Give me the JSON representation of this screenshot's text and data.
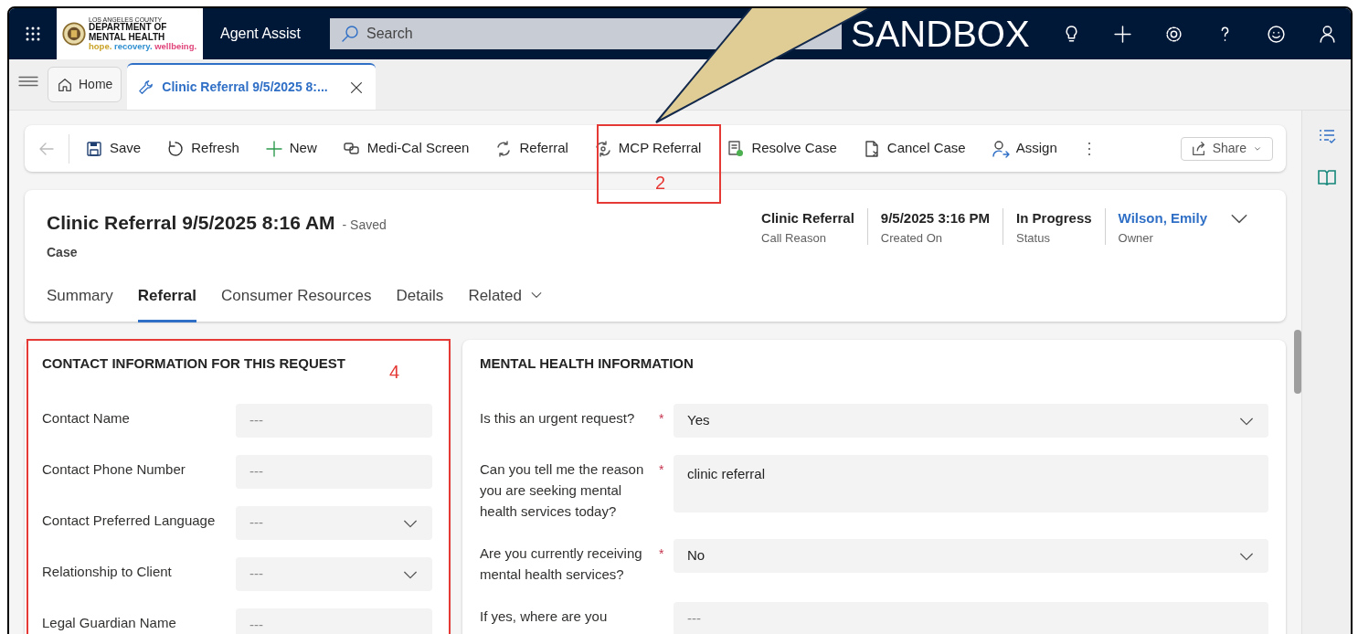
{
  "header": {
    "logo": {
      "lines": [
        "LOS ANGELES COUNTY",
        "DEPARTMENT OF",
        "MENTAL HEALTH"
      ],
      "tagline": [
        {
          "text": "hope.",
          "color": "#c9a227"
        },
        {
          "text": "recovery.",
          "color": "#2f8fd0"
        },
        {
          "text": "wellbeing.",
          "color": "#e0457b"
        }
      ]
    },
    "app_name": "Agent Assist",
    "search": {
      "placeholder": "Search"
    },
    "environment": "SANDBOX"
  },
  "session_tabs": [
    {
      "label": "Home",
      "kind": "home",
      "selected": false
    },
    {
      "label": "Clinic Referral 9/5/2025 8:...",
      "kind": "case",
      "selected": true
    }
  ],
  "command_bar": [
    {
      "label": "Save",
      "kind": "save"
    },
    {
      "label": "Refresh",
      "kind": "refresh"
    },
    {
      "label": "New",
      "kind": "new"
    },
    {
      "label": "Medi-Cal Screen",
      "kind": "chat"
    },
    {
      "label": "Referral",
      "kind": "cycle"
    },
    {
      "label": "MCP Referral",
      "kind": "cycle2"
    },
    {
      "label": "Resolve Case",
      "kind": "resolve"
    },
    {
      "label": "Cancel Case",
      "kind": "cancel"
    },
    {
      "label": "Assign",
      "kind": "assign"
    }
  ],
  "share": "Share",
  "record": {
    "title": "Clinic Referral 9/5/2025 8:16 AM",
    "save_state": "- Saved",
    "entity": "Case",
    "header_fields": [
      {
        "value": "Clinic Referral",
        "label": "Call Reason",
        "link": false
      },
      {
        "value": "9/5/2025 3:16 PM",
        "label": "Created On",
        "link": false
      },
      {
        "value": "In Progress",
        "label": "Status",
        "link": false
      },
      {
        "value": "Wilson, Emily",
        "label": "Owner",
        "link": true
      }
    ]
  },
  "form_tabs": [
    {
      "label": "Summary",
      "selected": false,
      "dropdown": false
    },
    {
      "label": "Referral",
      "selected": true,
      "dropdown": false
    },
    {
      "label": "Consumer Resources",
      "selected": false,
      "dropdown": false
    },
    {
      "label": "Details",
      "selected": false,
      "dropdown": false
    },
    {
      "label": "Related",
      "selected": false,
      "dropdown": true
    }
  ],
  "sections": [
    {
      "title": "CONTACT INFORMATION FOR THIS REQUEST",
      "fields": [
        {
          "label": "Contact Name",
          "placeholder": "---",
          "kind": "text"
        },
        {
          "label": "Contact Phone Number",
          "placeholder": "---",
          "kind": "text"
        },
        {
          "label": "Contact Preferred Language",
          "placeholder": "---",
          "kind": "select"
        },
        {
          "label": "Relationship to Client",
          "placeholder": "---",
          "kind": "select"
        },
        {
          "label": "Legal Guardian Name",
          "placeholder": "---",
          "kind": "text"
        }
      ]
    },
    {
      "title": "MENTAL HEALTH INFORMATION",
      "fields": [
        {
          "label": "Is this an urgent request?",
          "required_mark": "*",
          "value": "Yes",
          "kind": "select"
        },
        {
          "label": "Can you tell me the reason you are seeking mental health services today?",
          "required_mark": "*",
          "value": "clinic referral",
          "kind": "textarea"
        },
        {
          "label": "Are you currently receiving mental health services?",
          "required_mark": "*",
          "value": "No",
          "kind": "select"
        },
        {
          "label": "If yes, where are you",
          "placeholder": "---",
          "kind": "text"
        }
      ]
    }
  ],
  "annotations": [
    {
      "number": "2"
    },
    {
      "number": "4"
    }
  ]
}
